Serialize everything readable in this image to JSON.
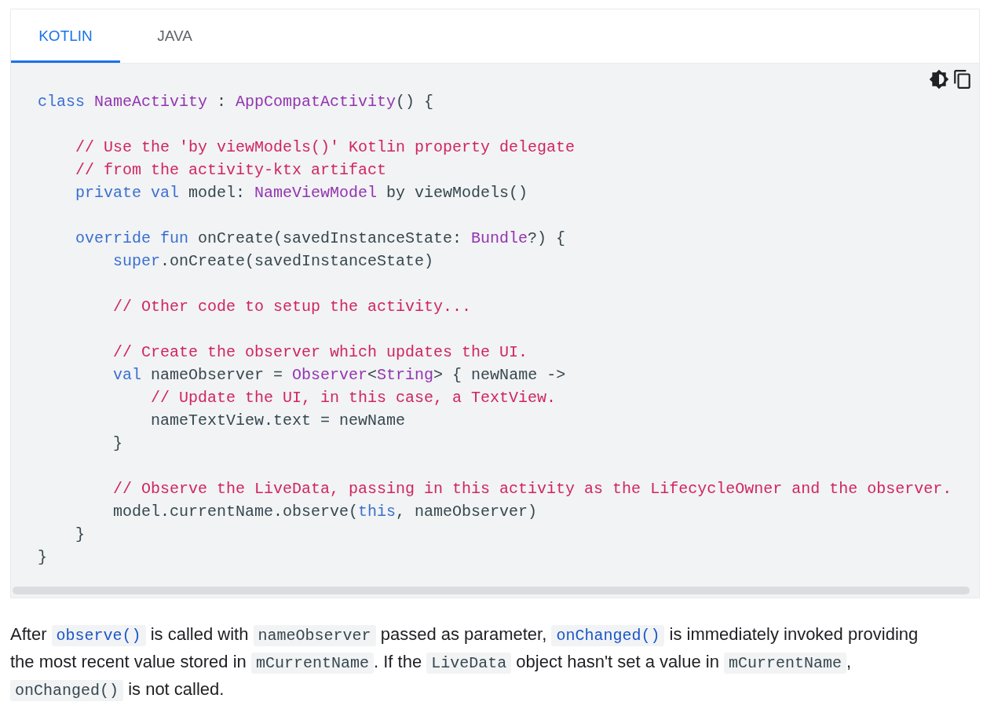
{
  "tabs": [
    {
      "label": "KOTLIN",
      "selected": true
    },
    {
      "label": "JAVA",
      "selected": false
    }
  ],
  "code_lines": [
    {
      "tokens": [
        {
          "kind": "keyword",
          "text": "class "
        },
        {
          "kind": "type",
          "text": "NameActivity"
        },
        {
          "kind": "plain",
          "text": " : "
        },
        {
          "kind": "type",
          "text": "AppCompatActivity"
        },
        {
          "kind": "plain",
          "text": "() {"
        }
      ]
    },
    {
      "gap_before": true,
      "tokens": [
        {
          "kind": "comment",
          "text": "    // Use the 'by viewModels()' Kotlin property delegate"
        }
      ]
    },
    {
      "tokens": [
        {
          "kind": "comment",
          "text": "    // from the activity-ktx artifact"
        }
      ]
    },
    {
      "tokens": [
        {
          "kind": "keyword",
          "text": "    private val"
        },
        {
          "kind": "plain",
          "text": " model: "
        },
        {
          "kind": "type",
          "text": "NameViewModel"
        },
        {
          "kind": "plain",
          "text": " by viewModels()"
        }
      ]
    },
    {
      "gap_before": true,
      "tokens": [
        {
          "kind": "keyword",
          "text": "    override fun"
        },
        {
          "kind": "plain",
          "text": " onCreate(savedInstanceState: "
        },
        {
          "kind": "type",
          "text": "Bundle"
        },
        {
          "kind": "plain",
          "text": "?) {"
        }
      ]
    },
    {
      "tokens": [
        {
          "kind": "keyword",
          "text": "        super"
        },
        {
          "kind": "plain",
          "text": ".onCreate(savedInstanceState)"
        }
      ]
    },
    {
      "gap_before": true,
      "tokens": [
        {
          "kind": "comment",
          "text": "        // Other code to setup the activity..."
        }
      ]
    },
    {
      "gap_before": true,
      "tokens": [
        {
          "kind": "comment",
          "text": "        // Create the observer which updates the UI."
        }
      ]
    },
    {
      "tokens": [
        {
          "kind": "keyword",
          "text": "        val"
        },
        {
          "kind": "plain",
          "text": " nameObserver = "
        },
        {
          "kind": "type",
          "text": "Observer"
        },
        {
          "kind": "plain",
          "text": "<"
        },
        {
          "kind": "type",
          "text": "String"
        },
        {
          "kind": "plain",
          "text": "> { newName ->"
        }
      ]
    },
    {
      "tokens": [
        {
          "kind": "comment",
          "text": "            // Update the UI, in this case, a TextView."
        }
      ]
    },
    {
      "tokens": [
        {
          "kind": "plain",
          "text": "            nameTextView.text = newName"
        }
      ]
    },
    {
      "tokens": [
        {
          "kind": "plain",
          "text": "        }"
        }
      ]
    },
    {
      "gap_before": true,
      "tokens": [
        {
          "kind": "comment",
          "text": "        // Observe the LiveData, passing in this activity as the LifecycleOwner and the observer."
        }
      ]
    },
    {
      "tokens": [
        {
          "kind": "plain",
          "text": "        model.currentName.observe("
        },
        {
          "kind": "keyword",
          "text": "this"
        },
        {
          "kind": "plain",
          "text": ", nameObserver)"
        }
      ]
    },
    {
      "tokens": [
        {
          "kind": "plain",
          "text": "    }"
        }
      ]
    },
    {
      "tokens": [
        {
          "kind": "plain",
          "text": "}"
        }
      ]
    }
  ],
  "paragraph": [
    {
      "kind": "text",
      "text": "After "
    },
    {
      "kind": "code_link",
      "text": "observe()"
    },
    {
      "kind": "text",
      "text": " is called with "
    },
    {
      "kind": "code",
      "text": "nameObserver"
    },
    {
      "kind": "text",
      "text": " passed as parameter, "
    },
    {
      "kind": "code_link",
      "text": "onChanged()"
    },
    {
      "kind": "text",
      "text": " is immediately invoked providing the most recent value stored in "
    },
    {
      "kind": "code",
      "text": "mCurrentName"
    },
    {
      "kind": "text",
      "text": ". If the "
    },
    {
      "kind": "code",
      "text": "LiveData"
    },
    {
      "kind": "text",
      "text": " object hasn't set a value in "
    },
    {
      "kind": "code",
      "text": "mCurrentName"
    },
    {
      "kind": "text",
      "text": ", "
    },
    {
      "kind": "code",
      "text": "onChanged()"
    },
    {
      "kind": "text",
      "text": " is not called."
    }
  ]
}
